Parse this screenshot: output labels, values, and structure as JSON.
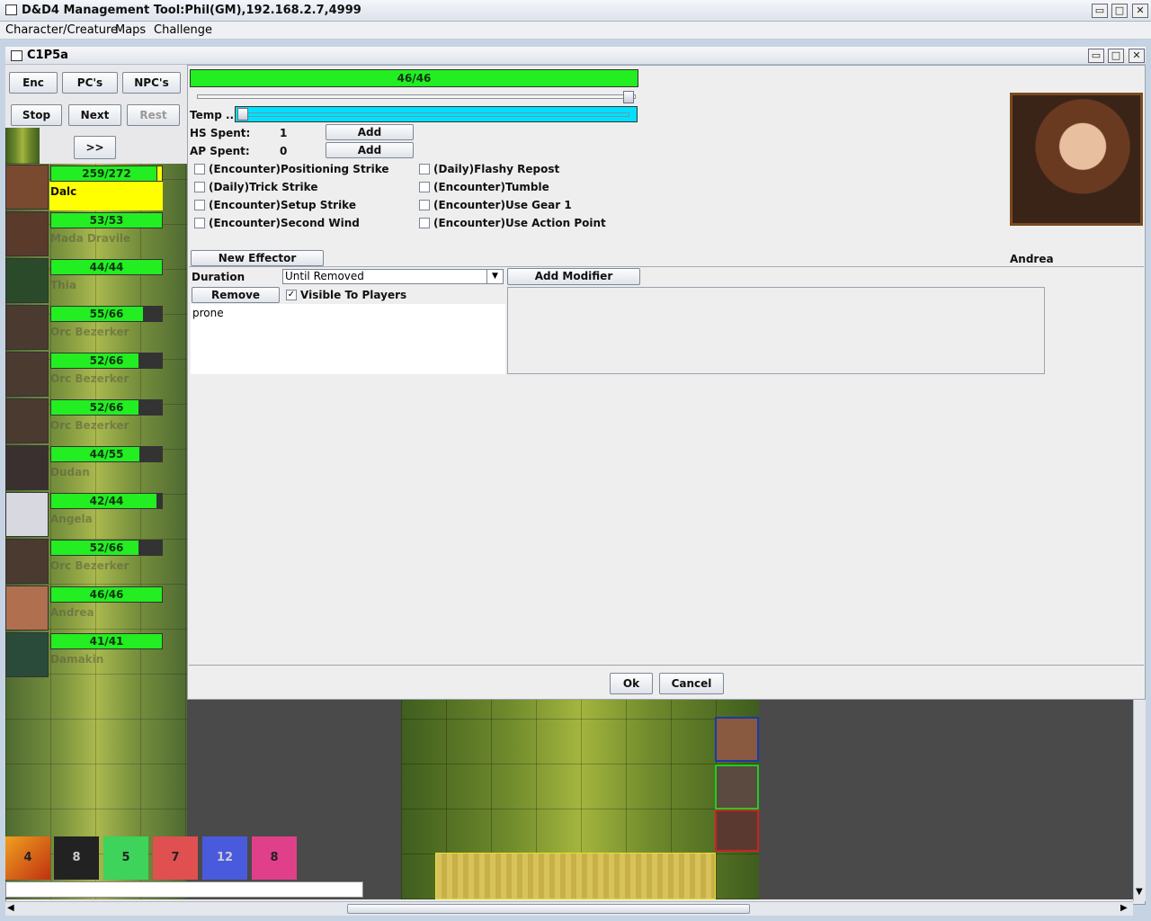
{
  "window": {
    "title": "D&D4 Management Tool:Phil(GM),192.168.2.7,4999"
  },
  "menu": [
    "Character/Creature",
    "Maps",
    "Challenge"
  ],
  "internal_window": {
    "title": "C1P5a"
  },
  "left_panel": {
    "buttons": {
      "enc": "Enc",
      "pcs": "PC's",
      "npcs": "NPC's",
      "stop": "Stop",
      "next": "Next",
      "rest": "Rest",
      "more": ">>"
    },
    "combatants": [
      {
        "hp": "259/272",
        "hp_fraction": 0.952,
        "name": "Dalc",
        "highlighted": true
      },
      {
        "hp": "53/53",
        "hp_fraction": 1.0,
        "name": "Mada Dravile"
      },
      {
        "hp": "44/44",
        "hp_fraction": 1.0,
        "name": "Thia"
      },
      {
        "hp": "55/66",
        "hp_fraction": 0.833,
        "name": "Orc Bezerker"
      },
      {
        "hp": "52/66",
        "hp_fraction": 0.788,
        "name": "Orc Bezerker"
      },
      {
        "hp": "52/66",
        "hp_fraction": 0.788,
        "name": "Orc Bezerker"
      },
      {
        "hp": "44/55",
        "hp_fraction": 0.8,
        "name": "Dudan"
      },
      {
        "hp": "42/44",
        "hp_fraction": 0.955,
        "name": "Angela"
      },
      {
        "hp": "52/66",
        "hp_fraction": 0.788,
        "name": "Orc Bezerker"
      },
      {
        "hp": "46/46",
        "hp_fraction": 1.0,
        "name": "Andrea"
      },
      {
        "hp": "41/41",
        "hp_fraction": 1.0,
        "name": "Damakin"
      }
    ],
    "dice": [
      "4",
      "8",
      "5",
      "7",
      "12",
      "8"
    ]
  },
  "dialog": {
    "hp_bar": {
      "text": "46/46",
      "fraction": 1.0
    },
    "temp_label": "Temp ...",
    "hs_label": "HS Spent:",
    "hs_value": "1",
    "hs_add": "Add",
    "ap_label": "AP Spent:",
    "ap_value": "0",
    "ap_add": "Add",
    "powers_left": [
      "(Encounter)Positioning Strike",
      "(Daily)Trick Strike",
      "(Encounter)Setup Strike",
      "(Encounter)Second Wind"
    ],
    "powers_right": [
      "(Daily)Flashy Repost",
      "(Encounter)Tumble",
      "(Encounter)Use Gear 1",
      "(Encounter)Use Action Point"
    ],
    "character_name": "Andrea",
    "new_effector": "New Effector",
    "duration_label": "Duration",
    "duration_value": "Until Removed",
    "add_modifier": "Add Modifier",
    "remove": "Remove",
    "visible_to_players": "Visible To Players",
    "visible_checked": true,
    "effect_text": "prone",
    "ok": "Ok",
    "cancel": "Cancel"
  },
  "colors": {
    "hp_green": "#22ee22",
    "highlight_yellow": "#ffff00",
    "temp_cyan": "#00e0ff"
  }
}
